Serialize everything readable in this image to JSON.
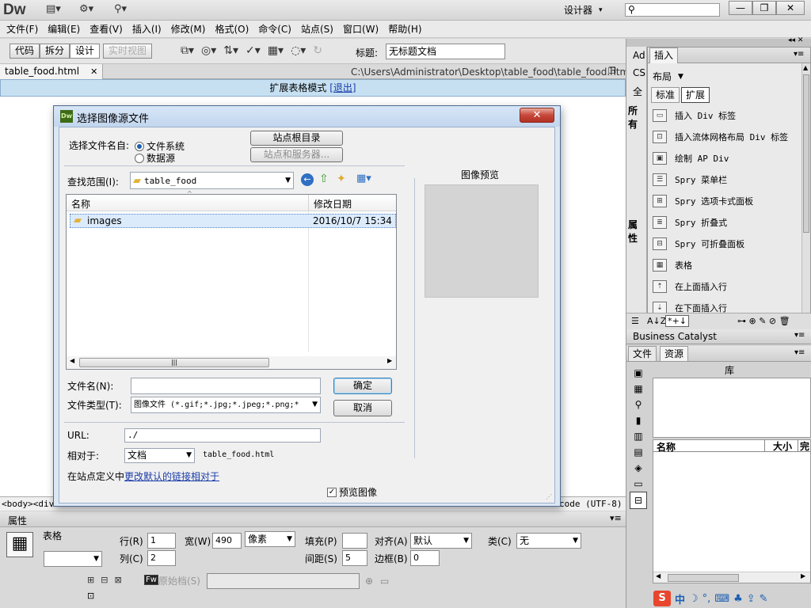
{
  "app": {
    "logo": "Dw",
    "workspace": "设计器",
    "search_placeholder": ""
  },
  "menu": [
    "文件(F)",
    "编辑(E)",
    "查看(V)",
    "插入(I)",
    "修改(M)",
    "格式(O)",
    "命令(C)",
    "站点(S)",
    "窗口(W)",
    "帮助(H)"
  ],
  "toolbar": {
    "views": [
      "代码",
      "拆分",
      "设计",
      "实时视图"
    ],
    "title_label": "标题:",
    "title_value": "无标题文档"
  },
  "document": {
    "tab_name": "table_food.html",
    "path": "C:\\Users\\Administrator\\Desktop\\table_food\\table_food.html",
    "mode_text": "扩展表格模式",
    "exit_link": "[退出]",
    "status_tags": "<body><div",
    "encoding": "code (UTF-8)"
  },
  "properties": {
    "header": "属性",
    "type_label": "表格",
    "rows_label": "行(R)",
    "rows_value": "1",
    "cols_label": "列(C)",
    "cols_value": "2",
    "width_label": "宽(W)",
    "width_value": "490",
    "unit_value": "像素",
    "fill_label": "填充(P)",
    "fill_value": "",
    "spacing_label": "间距(S)",
    "spacing_value": "5",
    "align_label": "对齐(A)",
    "align_value": "默认",
    "border_label": "边框(B)",
    "border_value": "0",
    "class_label": "类(C)",
    "class_value": "无",
    "original_label": "原始档(S)"
  },
  "right_panel": {
    "collapsed_tabs": [
      "Ad",
      "CS",
      "全",
      "所有",
      "属性"
    ],
    "insert_tab": "插入",
    "layout_label": "布局",
    "mode_tabs": [
      "标准",
      "扩展"
    ],
    "insert_items": [
      {
        "label": "插入 Div 标签",
        "icon": "div-icon"
      },
      {
        "label": "插入流体网格布局 Div 标签",
        "icon": "fluid-grid-icon"
      },
      {
        "label": "绘制 AP Div",
        "icon": "ap-div-icon"
      },
      {
        "label": "Spry 菜单栏",
        "icon": "spry-menu-icon"
      },
      {
        "label": "Spry 选项卡式面板",
        "icon": "spry-tab-icon"
      },
      {
        "label": "Spry 折叠式",
        "icon": "spry-accordion-icon"
      },
      {
        "label": "Spry 可折叠面板",
        "icon": "spry-collapsible-icon"
      },
      {
        "label": "表格",
        "icon": "table-icon"
      },
      {
        "label": "在上面插入行",
        "icon": "insert-row-above-icon"
      },
      {
        "label": "在下面插入行",
        "icon": "insert-row-below-icon"
      }
    ],
    "sort_label": "A↓Z",
    "bc_label": "Business Catalyst",
    "files_tab": "文件",
    "assets_tab": "资源",
    "library_label": "库",
    "col_name": "名称",
    "col_size": "大小",
    "col_full": "完"
  },
  "dialog": {
    "title": "选择图像源文件",
    "close": "✕",
    "select_from_label": "选择文件名自:",
    "radio_filesystem": "文件系统",
    "radio_datasource": "数据源",
    "site_root_btn": "站点根目录",
    "site_server_btn": "站点和服务器...",
    "lookin_label": "查找范围(I):",
    "lookin_value": "table_food",
    "col_name": "名称",
    "col_date": "修改日期",
    "files": [
      {
        "name": "images",
        "date": "2016/10/7 15:34"
      }
    ],
    "filename_label": "文件名(N):",
    "filename_value": "",
    "filetype_label": "文件类型(T):",
    "filetype_value": "图像文件 (*.gif;*.jpg;*.jpeg;*.png;*",
    "ok_btn": "确定",
    "cancel_btn": "取消",
    "url_label": "URL:",
    "url_value": "./",
    "relative_label": "相对于:",
    "relative_value": "文档",
    "relative_file": "table_food.html",
    "site_def_text": "在站点定义中",
    "site_def_link": "更改默认的链接相对于",
    "preview_title": "图像预览",
    "preview_checkbox": "预览图像"
  },
  "ime": [
    "中"
  ]
}
